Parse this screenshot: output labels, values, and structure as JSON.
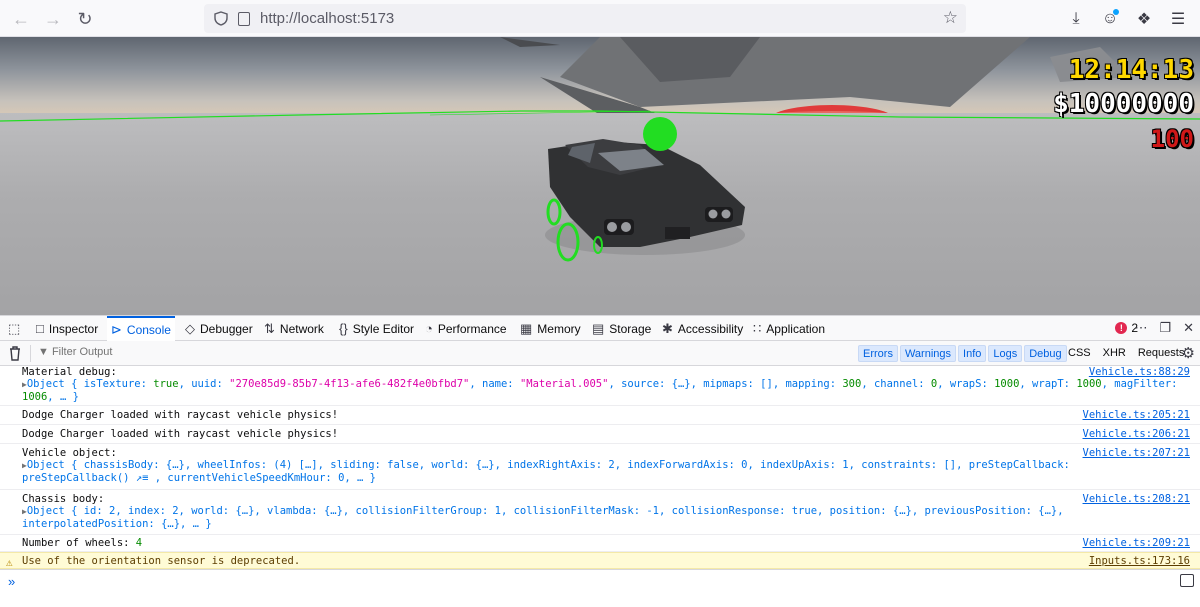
{
  "browser": {
    "url_host": "http://localhost",
    "url_port": ":5173",
    "icons": [
      "back-arrow-icon",
      "forward-arrow-icon",
      "reload-icon",
      "shield-icon",
      "page-icon",
      "star-icon",
      "download-icon",
      "account-icon",
      "extensions-icon",
      "menu-icon"
    ]
  },
  "game": {
    "hud_time": "12:14:13",
    "hud_money": "$10000000",
    "hud_health": "100",
    "colors": {
      "time": "#ffd800",
      "money": "#ffffff",
      "health": "#d01818",
      "debug_wire": "#22dd22"
    }
  },
  "devtools": {
    "tabs": [
      {
        "label": "Inspector",
        "icon": "inspector-icon"
      },
      {
        "label": "Console",
        "icon": "console-icon",
        "selected": true
      },
      {
        "label": "Debugger",
        "icon": "debugger-icon"
      },
      {
        "label": "Network",
        "icon": "network-icon"
      },
      {
        "label": "Style Editor",
        "icon": "style-editor-icon"
      },
      {
        "label": "Performance",
        "icon": "performance-icon"
      },
      {
        "label": "Memory",
        "icon": "memory-icon"
      },
      {
        "label": "Storage",
        "icon": "storage-icon"
      },
      {
        "label": "Accessibility",
        "icon": "accessibility-icon"
      },
      {
        "label": "Application",
        "icon": "application-icon"
      }
    ],
    "error_count": "2",
    "filter_placeholder": "Filter Output",
    "filter_levels": [
      "Errors",
      "Warnings",
      "Info",
      "Logs",
      "Debug"
    ],
    "filter_extra": [
      "CSS",
      "XHR",
      "Requests"
    ],
    "messages": {
      "m1_text": "Material debug:",
      "m1_obj_a": "Object { isTexture: ",
      "m1_obj_b": "true",
      "m1_obj_c": ", uuid: ",
      "m1_obj_d": "\"270e85d9-85b7-4f13-afe6-482f4e0bfbd7\"",
      "m1_obj_e": ", name: ",
      "m1_obj_f": "\"Material.005\"",
      "m1_obj_g": ", source: {…}, mipmaps: [], mapping: ",
      "m1_obj_h": "300",
      "m1_obj_i": ", channel: ",
      "m1_obj_j": "0",
      "m1_obj_k": ", wrapS: ",
      "m1_obj_l": "1000",
      "m1_obj_m": ", wrapT: ",
      "m1_obj_n": "1000",
      "m1_obj_o": ", magFilter:",
      "m1_obj2_a": "1006",
      "m1_obj2_b": ", … }",
      "m1_src": "Vehicle.ts:88:29",
      "m2_text": "Dodge Charger loaded with raycast vehicle physics!",
      "m2_src": "Vehicle.ts:205:21",
      "m3_text": "Dodge Charger loaded with raycast vehicle physics!",
      "m3_src": "Vehicle.ts:206:21",
      "m4_text": "Vehicle object:",
      "m4_line1": "Object { chassisBody: {…}, wheelInfos: (4) […], sliding: false, world: {…}, indexRightAxis: 2, indexForwardAxis: 0, indexUpAxis: 1, constraints: [], preStepCallback:",
      "m4_line2": "preStepCallback() ↗≡ , currentVehicleSpeedKmHour: 0, … }",
      "m4_src": "Vehicle.ts:207:21",
      "m5_text": "Chassis body:",
      "m5_line1": "Object { id: 2, index: 2, world: {…}, vlambda: {…}, collisionFilterGroup: 1, collisionFilterMask: -1, collisionResponse: true, position: {…}, previousPosition: {…},",
      "m5_line2": "interpolatedPosition: {…}, … }",
      "m5_src": "Vehicle.ts:208:21",
      "m6_text_a": "Number of wheels: ",
      "m6_text_b": "4",
      "m6_src": "Vehicle.ts:209:21",
      "m7_text": "Use of the orientation sensor is deprecated.",
      "m7_src": "Inputs.ts:173:16"
    }
  }
}
